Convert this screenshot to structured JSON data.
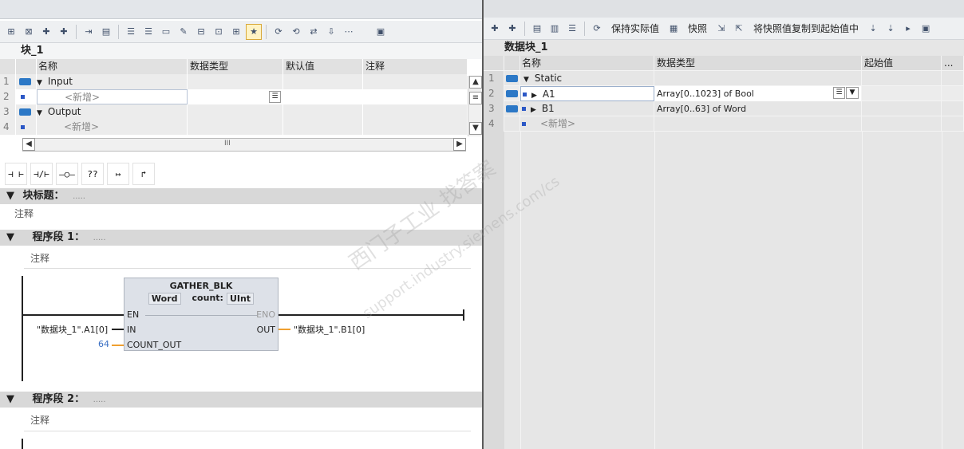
{
  "left": {
    "block_title": "块_1",
    "interface": {
      "headers": [
        "名称",
        "数据类型",
        "默认值",
        "注释"
      ],
      "rows": [
        {
          "num": "1",
          "name": "Input",
          "expand": "▼",
          "type": "",
          "default": "",
          "comment": ""
        },
        {
          "num": "2",
          "name": "<新增>",
          "expand": "",
          "type": "",
          "default": "",
          "comment": ""
        },
        {
          "num": "3",
          "name": "Output",
          "expand": "▼",
          "type": "",
          "default": "",
          "comment": ""
        },
        {
          "num": "4",
          "name": "<新增>",
          "expand": "",
          "type": "",
          "default": "",
          "comment": ""
        }
      ],
      "hscroll_mark": "III"
    },
    "ladder_buttons": [
      "⊣ ⊢",
      "⊣/⊢",
      "–○–",
      "??",
      "↦",
      "↱"
    ],
    "block_heading": {
      "label": "块标题：",
      "dots": ".....",
      "comment": "注释"
    },
    "network1": {
      "label": "程序段 1：",
      "dots": ".....",
      "comment": "注释",
      "fb": {
        "name": "GATHER_BLK",
        "type1": "Word",
        "count_label": "count:",
        "type2": "UInt",
        "en": "EN",
        "eno": "ENO",
        "in": "IN",
        "out": "OUT",
        "count_out": "COUNT_OUT",
        "in_operand": "\"数据块_1\".A1[0]",
        "out_operand": "\"数据块_1\".B1[0]",
        "count_value": "64"
      }
    },
    "network2": {
      "label": "程序段 2：",
      "dots": ".....",
      "comment": "注释"
    }
  },
  "right": {
    "toolbar_text": {
      "keep_actual": "保持实际值",
      "snapshot": "快照",
      "copy_snapshot": "将快照值复制到起始值中"
    },
    "block_title": "数据块_1",
    "headers": [
      "名称",
      "数据类型",
      "起始值",
      "..."
    ],
    "rows": [
      {
        "num": "1",
        "name": "Static",
        "expand": "▼",
        "type": ""
      },
      {
        "num": "2",
        "name": "A1",
        "expand": "▶",
        "type": "Array[0..1023] of Bool"
      },
      {
        "num": "3",
        "name": "B1",
        "expand": "▶",
        "type": "Array[0..63] of Word"
      },
      {
        "num": "4",
        "name": "<新增>",
        "expand": "",
        "type": ""
      }
    ]
  },
  "watermark": {
    "line1": "西门子工业  找答案",
    "line2": "support.industry.siemens.com/cs"
  },
  "colors": {
    "accent_blue": "#2c78c6",
    "count_orange": "#f0a030",
    "highlight_yellow": "#fff3c4"
  }
}
